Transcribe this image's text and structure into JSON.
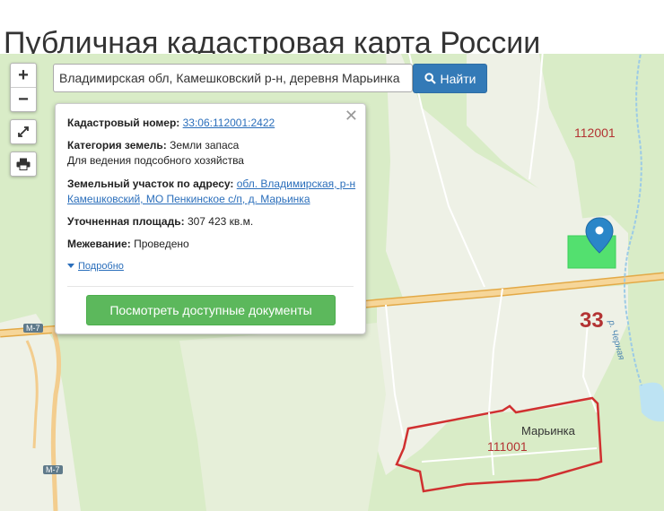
{
  "page": {
    "title": "Публичная кадастровая карта России"
  },
  "search": {
    "value": "Владимирская обл, Камешковский р-н, деревня Марьинка",
    "button_label": "Найти"
  },
  "controls": {
    "zoom_in": "+",
    "zoom_out": "−",
    "icons": [
      "zoom-in-icon",
      "zoom-out-icon",
      "fullscreen-icon",
      "print-icon",
      "search-icon",
      "close-icon",
      "caret-down-icon",
      "location-marker-icon"
    ]
  },
  "popup": {
    "cadastral_number_label": "Кадастровый номер:",
    "cadastral_number": "33:06:112001:2422",
    "category_label": "Категория земель:",
    "category": "Земли запаса",
    "usage": "Для ведения подсобного хозяйства",
    "address_label": "Земельный участок по адресу:",
    "address": "обл. Владимирская, р-н Камешковский, МО Пенкинское с/п, д. Марьинка",
    "area_label": "Уточненная площадь:",
    "area": "307 423 кв.м.",
    "survey_label": "Межевание:",
    "survey": "Проведено",
    "more_link": "Подробно",
    "documents_button": "Посмотреть доступные документы",
    "close_symbol": "✕"
  },
  "map": {
    "labels": {
      "quarter_north": "112001",
      "region_code": "33",
      "village_name": "Марьинка",
      "quarter_south": "111001",
      "road_m7_top": "М-7",
      "road_m7_bottom": "М-7",
      "river": "р. Черная"
    },
    "colors": {
      "forest": "#d9ecc7",
      "field": "#eef1e6",
      "highway": "#f1c476",
      "parcel": "#53e06f",
      "boundary": "#d03030",
      "marker": "#2a86c8",
      "accent_blue": "#337ab7",
      "accent_green": "#5cb85c"
    }
  }
}
